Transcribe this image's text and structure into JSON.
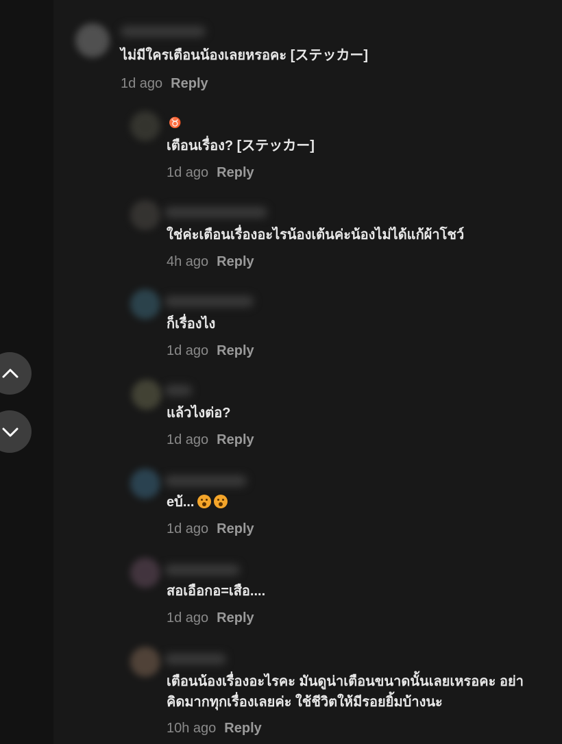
{
  "nav": {
    "up_icon": "chevron-up-icon",
    "down_icon": "chevron-down-icon"
  },
  "comments": [
    {
      "text": "ไม่มีใครเตือนน้องเลยหรอคะ [ステッカー]",
      "time": "1d ago",
      "reply": "Reply",
      "avatar_color": "#5a5a5a"
    }
  ],
  "replies": [
    {
      "badge": "♉",
      "text": "เตือนเรื่อง? [ステッカー]",
      "time": "1d ago",
      "reply": "Reply",
      "avatar_color": "#3a3a33"
    },
    {
      "text": "ใช่ค่ะเตือนเรื่องอะไรน้องเต้นค่ะน้องไม่ได้แก้ผ้าโชว์",
      "time": "4h ago",
      "reply": "Reply",
      "avatar_color": "#3a3835"
    },
    {
      "text": "ก็เรื่องไง",
      "time": "1d ago",
      "reply": "Reply",
      "avatar_color": "#2f4a55"
    },
    {
      "text": "แล้วไงต่อ?",
      "time": "1d ago",
      "reply": "Reply",
      "avatar_color": "#4a4a3a"
    },
    {
      "text": "eบ้...",
      "emoji_count": 2,
      "emoji_icon": "astonished-face-emoji",
      "time": "1d ago",
      "reply": "Reply",
      "avatar_color": "#2e4a5a"
    },
    {
      "text": "สอเอือกอ=เสือ....",
      "time": "1d ago",
      "reply": "Reply",
      "avatar_color": "#4a3a45"
    },
    {
      "text": "เตือนน้องเรื่องอะไรคะ มันดูน่าเตือนขนาดนั้นเลยเหรอคะ อย่าคิดมากทุกเรื่องเลยค่ะ ใช้ชีวิตให้มีรอยยิ้มบ้างนะ",
      "time": "10h ago",
      "reply": "Reply",
      "avatar_color": "#5a4a3e"
    }
  ]
}
